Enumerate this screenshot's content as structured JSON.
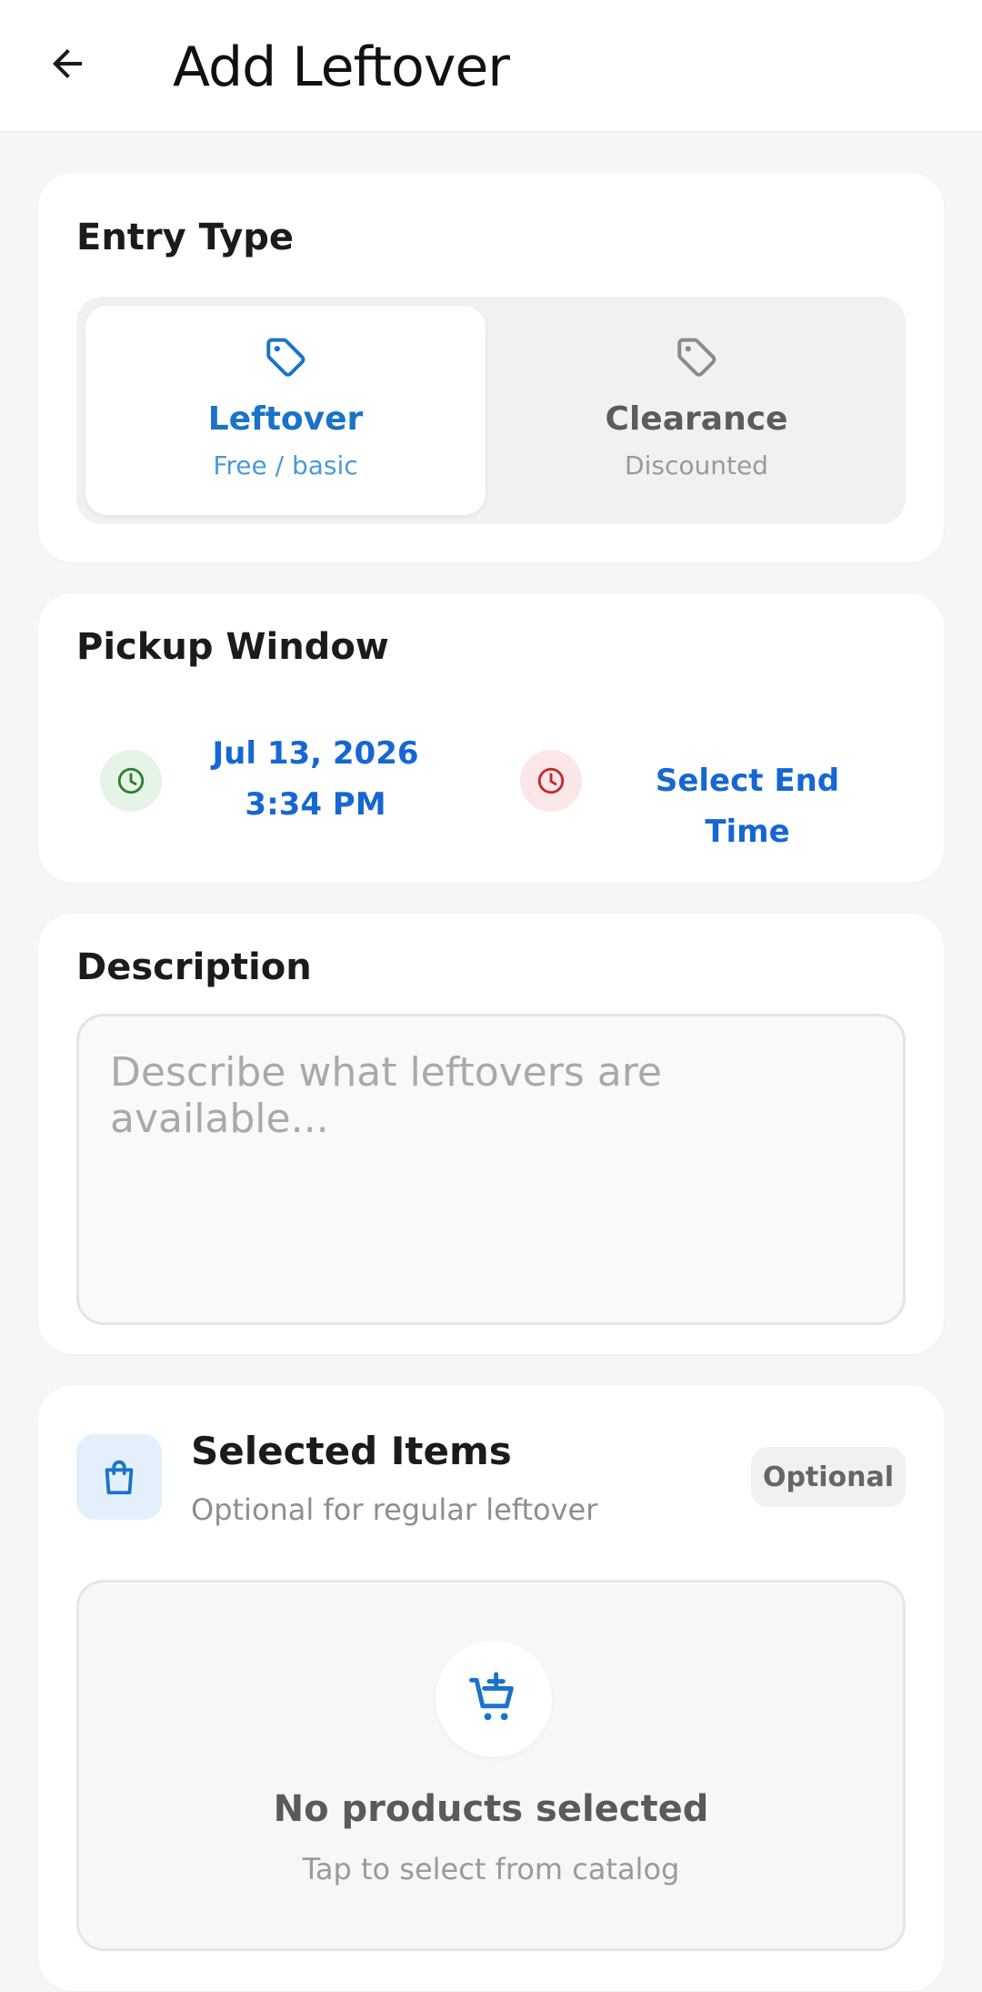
{
  "appbar": {
    "title": "Add Leftover",
    "back_icon": "arrow-left-icon"
  },
  "entry_type": {
    "title": "Entry Type",
    "options": [
      {
        "label": "Leftover",
        "sub": "Free / basic",
        "icon": "tag-icon",
        "selected": true
      },
      {
        "label": "Clearance",
        "sub": "Discounted",
        "icon": "tag-icon",
        "selected": false
      }
    ]
  },
  "pickup_window": {
    "title": "Pickup Window",
    "start_date": "Jul 13, 2026",
    "start_time": "3:34 PM",
    "end_label": "Select End Time"
  },
  "description": {
    "title": "Description",
    "placeholder": "Describe what leftovers are available...",
    "value": ""
  },
  "selected_items": {
    "title": "Selected Items",
    "subtitle": "Optional for regular leftover",
    "badge": "Optional",
    "empty_title": "No products selected",
    "empty_sub": "Tap to select from catalog"
  },
  "colors": {
    "accent_blue": "#1a73c9",
    "link_blue": "#1667d1",
    "start_green": "#2e7d32",
    "end_red": "#c62828"
  }
}
